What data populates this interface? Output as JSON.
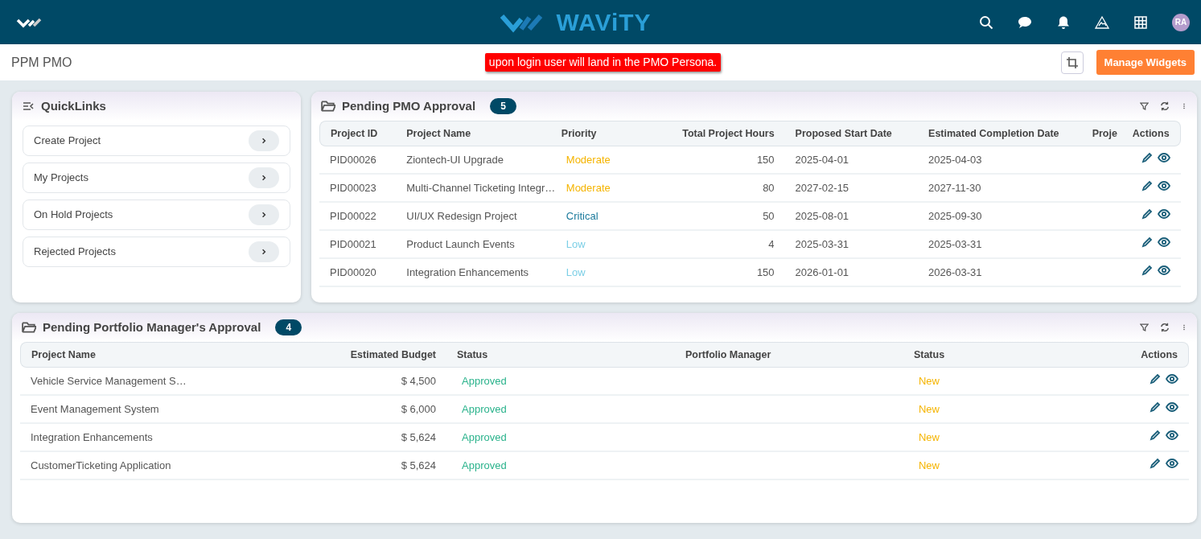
{
  "header": {
    "brand": "WAViTY",
    "avatar": "RA"
  },
  "subheader": {
    "title": "PPM PMO",
    "notice": "upon login user will land in the PMO Persona.",
    "button": "Manage Widgets"
  },
  "quicklinks": {
    "title": "QuickLinks",
    "items": [
      "Create Project",
      "My Projects",
      "On Hold Projects",
      "Rejected Projects"
    ]
  },
  "pmo_approval": {
    "title": "Pending PMO Approval",
    "count": "5",
    "columns": [
      {
        "label": "Project ID",
        "kind": "text"
      },
      {
        "label": "Project Name",
        "kind": "text"
      },
      {
        "label": "Priority",
        "kind": "tag"
      },
      {
        "label": "Total Project Hours",
        "kind": "number"
      },
      {
        "label": "Proposed Start Date",
        "kind": "text"
      },
      {
        "label": "Estimated Completion Date",
        "kind": "text"
      },
      {
        "label": "Proje",
        "kind": "blank"
      },
      {
        "label": "Actions",
        "kind": "actions"
      }
    ],
    "rows": [
      {
        "cells": [
          "PID00026",
          "Ziontech-UI Upgrade",
          {
            "text": "Moderate",
            "color": "#f5b400"
          },
          "150",
          "2025-04-01",
          "2025-04-03"
        ]
      },
      {
        "cells": [
          "PID00023",
          "Multi-Channel Ticketing Integr…",
          {
            "text": "Moderate",
            "color": "#f5b400"
          },
          "80",
          "2027-02-15",
          "2027-11-30"
        ]
      },
      {
        "cells": [
          "PID00022",
          "UI/UX Redesign Project",
          {
            "text": "Critical",
            "color": "#1b7a9c"
          },
          "50",
          "2025-08-01",
          "2025-09-30"
        ]
      },
      {
        "cells": [
          "PID00021",
          "Product Launch Events",
          {
            "text": "Low",
            "color": "#7ccfe6"
          },
          "4",
          "2025-03-31",
          "2025-03-31"
        ]
      },
      {
        "cells": [
          "PID00020",
          "Integration Enhancements",
          {
            "text": "Low",
            "color": "#7ccfe6"
          },
          "150",
          "2026-01-01",
          "2026-03-31"
        ]
      }
    ]
  },
  "portfolio_approval": {
    "title": "Pending Portfolio Manager's Approval",
    "count": "4",
    "columns": [
      {
        "label": "Project Name",
        "kind": "text"
      },
      {
        "label": "Estimated Budget",
        "kind": "number"
      },
      {
        "label": "Status",
        "kind": "tag"
      },
      {
        "label": "Portfolio Manager",
        "kind": "blank"
      },
      {
        "label": "Status",
        "kind": "center-tag"
      },
      {
        "label": "Actions",
        "kind": "actions"
      }
    ],
    "rows": [
      {
        "cells": [
          "Vehicle Service Management S…",
          "$ 4,500",
          {
            "text": "Approved",
            "color": "#2bb38c"
          },
          {
            "text": "New",
            "color": "#f5b400"
          }
        ]
      },
      {
        "cells": [
          "Event Management System",
          "$ 6,000",
          {
            "text": "Approved",
            "color": "#2bb38c"
          },
          {
            "text": "New",
            "color": "#f5b400"
          }
        ]
      },
      {
        "cells": [
          "Integration Enhancements",
          "$ 5,624",
          {
            "text": "Approved",
            "color": "#2bb38c"
          },
          {
            "text": "New",
            "color": "#f5b400"
          }
        ]
      },
      {
        "cells": [
          "CustomerTicketing Application",
          "$ 5,624",
          {
            "text": "Approved",
            "color": "#2bb38c"
          },
          {
            "text": "New",
            "color": "#f5b400"
          }
        ]
      }
    ]
  }
}
